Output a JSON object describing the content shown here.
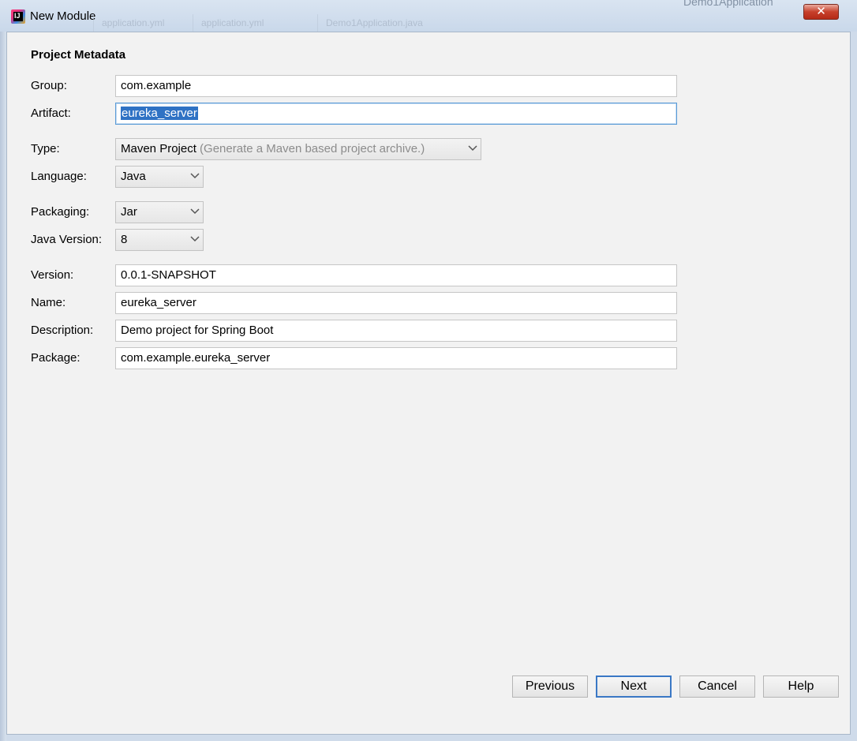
{
  "window": {
    "title": "New Module",
    "close_label": "✕",
    "background_tabs": [
      "application.yml",
      "application.yml",
      "Demo1Application.java"
    ],
    "background_top_label": "Demo1Application"
  },
  "form": {
    "heading": "Project Metadata",
    "group": {
      "label": "Group:",
      "value": "com.example"
    },
    "artifact": {
      "label": "Artifact:",
      "value": "eureka_server"
    },
    "type": {
      "label": "Type:",
      "value": "Maven Project",
      "hint": "(Generate a Maven based project archive.)"
    },
    "language": {
      "label": "Language:",
      "value": "Java"
    },
    "packaging": {
      "label": "Packaging:",
      "value": "Jar"
    },
    "java_version": {
      "label": "Java Version:",
      "value": "8"
    },
    "version": {
      "label": "Version:",
      "value": "0.0.1-SNAPSHOT"
    },
    "name": {
      "label": "Name:",
      "value": "eureka_server"
    },
    "description": {
      "label": "Description:",
      "value": "Demo project for Spring Boot"
    },
    "package": {
      "label": "Package:",
      "value": "com.example.eureka_server"
    }
  },
  "buttons": {
    "previous": "Previous",
    "next": "Next",
    "cancel": "Cancel",
    "help": "Help"
  },
  "colors": {
    "selection": "#2f72c4",
    "focus_border": "#5a9bd6",
    "default_button_border": "#3a78c5"
  }
}
